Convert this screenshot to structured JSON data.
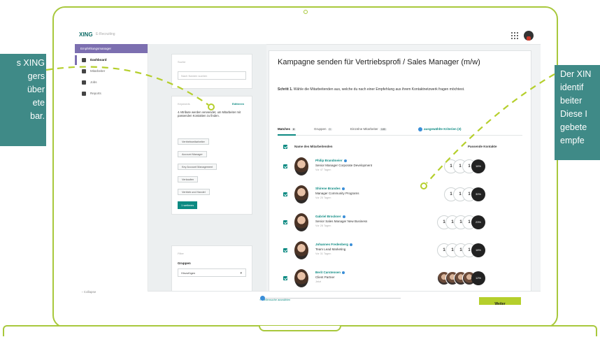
{
  "callouts": {
    "left": [
      "s XING",
      "gers",
      "über",
      "ete",
      "bar."
    ],
    "right": [
      "Der XIN",
      "identif",
      "beiter",
      "Diese I",
      "gebete",
      "empfe"
    ]
  },
  "header": {
    "logo": "XING",
    "subtitle": "E-Recruiting"
  },
  "sidebar": {
    "heading": "Empfehlungsmanager",
    "items": [
      {
        "label": "Dashboard",
        "icon": "heart-icon"
      },
      {
        "label": "Mitarbeiter",
        "icon": "person-icon"
      },
      {
        "label": "Jobs",
        "icon": "briefcase-icon"
      },
      {
        "label": "Reports",
        "icon": "chart-icon"
      }
    ],
    "collapse": "Collapse"
  },
  "filters": {
    "search_label": "Suche",
    "search_placeholder": "Nach Namen suchen",
    "keywords_label": "Keywords",
    "keywords_edit": "Editieren",
    "keywords_text": "4 Attribute werden verwendet, um Mitarbeiter mit passenden Kontakten zu finden.",
    "chips": [
      "Vertriebsmitarbeiter",
      "Account Manager",
      "Key Account Management",
      "Verkaufen",
      "Vertrieb und Handel"
    ],
    "apply_button": "1 weiteres",
    "groups_label": "Filter",
    "groups_title": "Gruppen",
    "groups_select": "Hinzufügen"
  },
  "main": {
    "title": "Kampagne senden für Vertriebsprofi / Sales Manager (m/w)",
    "step_bold": "Schritt 1.",
    "step_text": "Wähle die Mitarbeitenden aus, welche du nach einer Empfehlung aus ihrem Kontaktnetzwerk fragen möchtest.",
    "tabs": [
      {
        "label": "Matches",
        "count": "8"
      },
      {
        "label": "Gruppen",
        "count": "0"
      },
      {
        "label": "Einzelne Mitarbeiter",
        "count": "185"
      }
    ],
    "tab_info": "ausgewählte Kriterien (3)",
    "col_name": "Name des Mitarbeitenden",
    "col_contacts": "Passende Kontakte",
    "rows": [
      {
        "name": "Philip Brandmeier",
        "title": "Senior Manager Corporate Development",
        "loc": "Vor 47 Tagen",
        "more": "16%"
      },
      {
        "name": "Shirene Brandes",
        "title": "Manager Community Programs",
        "loc": "Vor 25 Tagen",
        "more": "30%"
      },
      {
        "name": "Gabriel Brockner",
        "title": "Senior Sales Manager New Business",
        "loc": "Vor 28 Tagen",
        "more": "23%"
      },
      {
        "name": "Johannes Fredenberg",
        "title": "Team Lead Marketing",
        "loc": "Vor 31 Tagen",
        "more": "18%"
      },
      {
        "name": "Berit Carstensen",
        "title": "Client Partner",
        "loc": "Jetzt",
        "more": "12%"
      }
    ],
    "footer_link": "< Stellensuche auswählen"
  },
  "next_button": "Weiter"
}
